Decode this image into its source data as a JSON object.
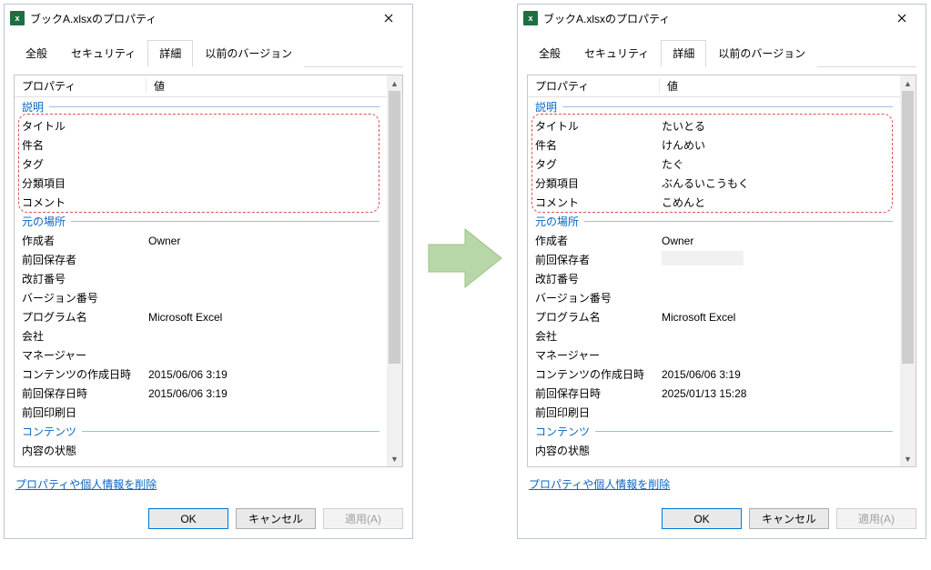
{
  "dialogs": [
    {
      "title": "ブックA.xlsxのプロパティ",
      "tabs": [
        "全般",
        "セキュリティ",
        "詳細",
        "以前のバージョン"
      ],
      "active_tab": 2,
      "columns": {
        "property": "プロパティ",
        "value": "値"
      },
      "groups": [
        {
          "label": "説明",
          "highlight": true,
          "rows": [
            {
              "name": "タイトル",
              "value": ""
            },
            {
              "name": "件名",
              "value": ""
            },
            {
              "name": "タグ",
              "value": ""
            },
            {
              "name": "分類項目",
              "value": ""
            },
            {
              "name": "コメント",
              "value": ""
            }
          ]
        },
        {
          "label": "元の場所",
          "rows": [
            {
              "name": "作成者",
              "value": "Owner"
            },
            {
              "name": "前回保存者",
              "value": ""
            },
            {
              "name": "改訂番号",
              "value": ""
            },
            {
              "name": "バージョン番号",
              "value": ""
            },
            {
              "name": "プログラム名",
              "value": "Microsoft Excel"
            },
            {
              "name": "会社",
              "value": ""
            },
            {
              "name": "マネージャー",
              "value": ""
            },
            {
              "name": "コンテンツの作成日時",
              "value": "2015/06/06 3:19"
            },
            {
              "name": "前回保存日時",
              "value": "2015/06/06 3:19"
            },
            {
              "name": "前回印刷日",
              "value": ""
            }
          ]
        },
        {
          "label": "コンテンツ",
          "rows": [
            {
              "name": "内容の状態",
              "value": ""
            }
          ]
        }
      ],
      "link": "プロパティや個人情報を削除",
      "buttons": {
        "ok": "OK",
        "cancel": "キャンセル",
        "apply": "適用(A)"
      }
    },
    {
      "title": "ブックA.xlsxのプロパティ",
      "tabs": [
        "全般",
        "セキュリティ",
        "詳細",
        "以前のバージョン"
      ],
      "active_tab": 2,
      "columns": {
        "property": "プロパティ",
        "value": "値"
      },
      "groups": [
        {
          "label": "説明",
          "highlight": true,
          "rows": [
            {
              "name": "タイトル",
              "value": "たいとる"
            },
            {
              "name": "件名",
              "value": "けんめい"
            },
            {
              "name": "タグ",
              "value": "たぐ"
            },
            {
              "name": "分類項目",
              "value": "ぶんるいこうもく"
            },
            {
              "name": "コメント",
              "value": "こめんと"
            }
          ]
        },
        {
          "label": "元の場所",
          "rows": [
            {
              "name": "作成者",
              "value": "Owner"
            },
            {
              "name": "前回保存者",
              "value": "",
              "redacted": true
            },
            {
              "name": "改訂番号",
              "value": ""
            },
            {
              "name": "バージョン番号",
              "value": ""
            },
            {
              "name": "プログラム名",
              "value": "Microsoft Excel"
            },
            {
              "name": "会社",
              "value": ""
            },
            {
              "name": "マネージャー",
              "value": ""
            },
            {
              "name": "コンテンツの作成日時",
              "value": "2015/06/06 3:19"
            },
            {
              "name": "前回保存日時",
              "value": "2025/01/13 15:28"
            },
            {
              "name": "前回印刷日",
              "value": ""
            }
          ]
        },
        {
          "label": "コンテンツ",
          "rows": [
            {
              "name": "内容の状態",
              "value": ""
            }
          ]
        }
      ],
      "link": "プロパティや個人情報を削除",
      "buttons": {
        "ok": "OK",
        "cancel": "キャンセル",
        "apply": "適用(A)"
      }
    }
  ],
  "arrow_color": "#b7d7a8"
}
